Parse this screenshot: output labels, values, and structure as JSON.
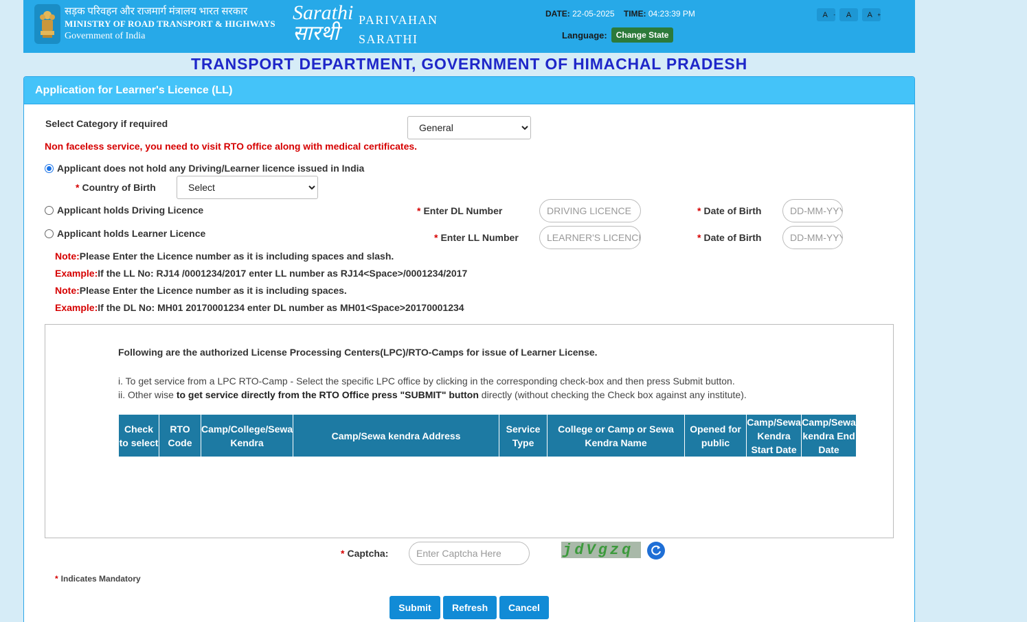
{
  "header": {
    "ministry_hindi": "सड़क परिवहन और राजमार्ग मंत्रालय भारत सरकार",
    "ministry_english": "MINISTRY OF ROAD TRANSPORT & HIGHWAYS",
    "government": "Government of India",
    "logo_line1": "Sarathi",
    "logo_line2": "सारथी",
    "app_name_line1": "PARIVAHAN",
    "app_name_line2": "SARATHI",
    "date_label": "DATE:",
    "date_value": "22-05-2025",
    "time_label": "TIME:",
    "time_value": "04:23:39 PM",
    "language_label": "Language:",
    "change_state_label": "Change State",
    "font_small": "A",
    "font_small_sup": "-",
    "font_normal": "A",
    "font_large": "A",
    "font_large_sup": "+"
  },
  "department_title": "TRANSPORT DEPARTMENT, GOVERNMENT OF HIMACHAL PRADESH",
  "panel_title": "Application for Learner's Licence (LL)",
  "category": {
    "label": "Select Category if required",
    "selected": "General"
  },
  "warning": "Non faceless service, you need to visit RTO office along with medical certificates.",
  "options": {
    "no_licence": "Applicant does not hold any Driving/Learner licence issued in India",
    "holds_dl": "Applicant holds Driving Licence",
    "holds_ll": "Applicant holds Learner Licence"
  },
  "country_of_birth": {
    "label": "Country of Birth",
    "selected": "Select"
  },
  "dl_number": {
    "label": "Enter DL Number",
    "placeholder": "DRIVING LICENCE"
  },
  "ll_number": {
    "label": "Enter LL Number",
    "placeholder": "LEARNER'S LICENCE"
  },
  "dob": {
    "label": "Date of Birth",
    "placeholder": "DD-MM-YYYY"
  },
  "notes": [
    {
      "tag": "Note:",
      "text": "Please Enter the Licence number as it is including spaces and slash."
    },
    {
      "tag": "Example:",
      "text": "If the LL No: RJ14 /0001234/2017 enter LL number as RJ14<Space>/0001234/2017"
    },
    {
      "tag": "Note:",
      "text": "Please Enter the Licence number as it is including spaces."
    },
    {
      "tag": "Example:",
      "text": "If the DL No: MH01 20170001234 enter DL number as MH01<Space>20170001234"
    }
  ],
  "lpc": {
    "title": "Following are the authorized License Processing Centers(LPC)/RTO-Camps for issue of Learner License.",
    "instruction1": "i. To get service from a LPC RTO-Camp - Select the specific LPC office by clicking in the corresponding check-box and then press Submit button.",
    "instruction2_prefix": "ii. Other wise ",
    "instruction2_bold": "to get service directly from the RTO Office press \"SUBMIT\" button",
    "instruction2_suffix": " directly (without checking the Check box against any institute).",
    "columns": [
      "Check to select",
      "RTO Code",
      "Camp/College/Sewa Kendra",
      "Camp/Sewa kendra Address",
      "Service Type",
      "College or Camp or Sewa Kendra Name",
      "Opened for public",
      "Camp/Sewa Kendra Start Date",
      "Camp/Sewa kendra End Date"
    ]
  },
  "captcha": {
    "label": "Captcha:",
    "placeholder": "Enter Captcha Here",
    "image_text": "jdVgzq"
  },
  "mandatory_note": "Indicates Mandatory",
  "required_mark": "*",
  "buttons": {
    "submit": "Submit",
    "refresh": "Refresh",
    "cancel": "Cancel"
  }
}
